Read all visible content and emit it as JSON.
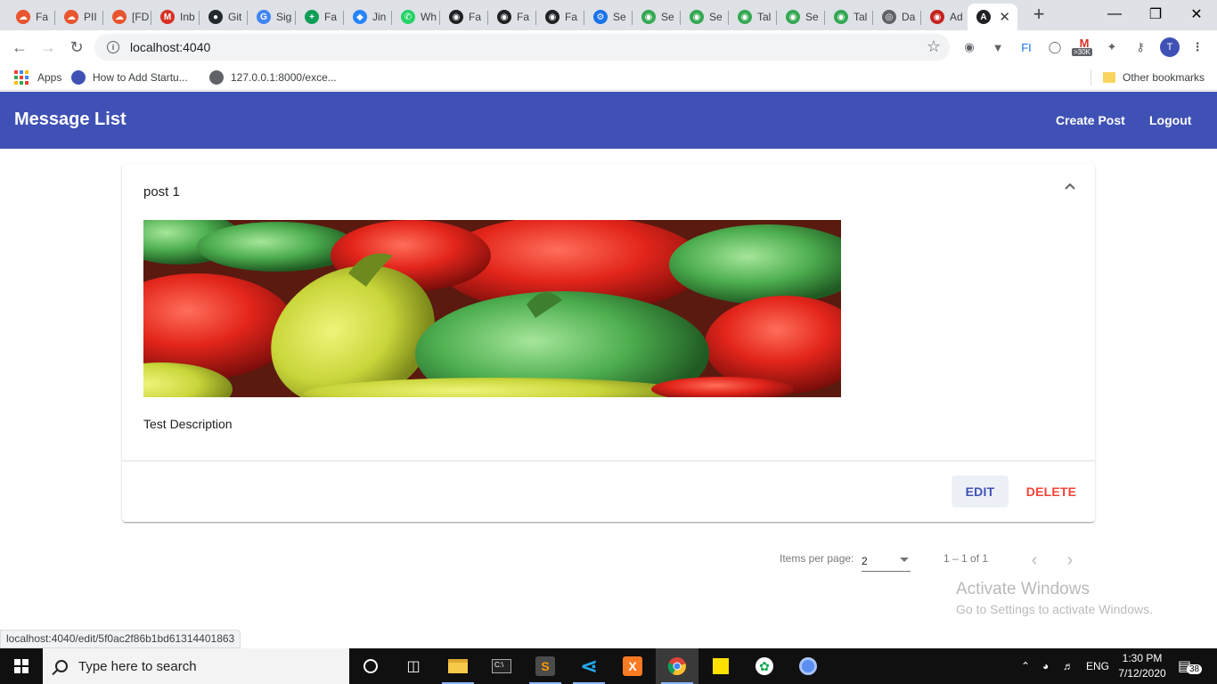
{
  "browser": {
    "tabs": [
      {
        "label": "Fa",
        "icon": "cloud-icon",
        "color": "#e8552f"
      },
      {
        "label": "PII",
        "icon": "cloud-icon",
        "color": "#e8552f"
      },
      {
        "label": "[FD",
        "icon": "cloud-icon",
        "color": "#e8552f"
      },
      {
        "label": "Inb",
        "icon": "gmail-icon",
        "color": "#d93025"
      },
      {
        "label": "Git",
        "icon": "github-icon",
        "color": "#24292e"
      },
      {
        "label": "Sig",
        "icon": "google-icon",
        "color": "#4285f4"
      },
      {
        "label": "Fa",
        "icon": "sheets-icon",
        "color": "#0f9d58"
      },
      {
        "label": "Jin",
        "icon": "jira-icon",
        "color": "#2684ff"
      },
      {
        "label": "Wh",
        "icon": "whatsapp-icon",
        "color": "#25d366"
      },
      {
        "label": "Fa",
        "icon": "site-icon",
        "color": "#202124"
      },
      {
        "label": "Fa",
        "icon": "site-icon",
        "color": "#202124"
      },
      {
        "label": "Fa",
        "icon": "site-icon",
        "color": "#202124"
      },
      {
        "label": "Se",
        "icon": "settings-icon",
        "color": "#1a73e8"
      },
      {
        "label": "Se",
        "icon": "site-icon",
        "color": "#34a853"
      },
      {
        "label": "Se",
        "icon": "site-icon",
        "color": "#34a853"
      },
      {
        "label": "Tal",
        "icon": "site-icon",
        "color": "#34a853"
      },
      {
        "label": "Se",
        "icon": "site-icon",
        "color": "#34a853"
      },
      {
        "label": "Tal",
        "icon": "site-icon",
        "color": "#34a853"
      },
      {
        "label": "Da",
        "icon": "globe-icon",
        "color": "#5f6368"
      },
      {
        "label": "Ad",
        "icon": "site-icon",
        "color": "#c5221f"
      }
    ],
    "active_tab": {
      "icon": "angular-icon",
      "color": "#202124"
    },
    "address": "localhost:4040",
    "bookmarks": {
      "apps_label": "Apps",
      "item1": "How to Add Startu...",
      "item2": "127.0.0.1:8000/exce...",
      "other": "Other bookmarks"
    },
    "ext_badge": ">30K",
    "profile_initial": "T"
  },
  "app": {
    "title": "Message List",
    "nav": {
      "create": "Create Post",
      "logout": "Logout"
    },
    "post": {
      "title": "post 1",
      "description": "Test Description",
      "edit_label": "EDIT",
      "delete_label": "DELETE"
    },
    "paginator": {
      "items_per_page_label": "Items per page:",
      "page_size": "2",
      "range": "1 – 1 of 1"
    }
  },
  "status_url": "localhost:4040/edit/5f0ac2f86b1bd61314401863",
  "watermark": {
    "line1": "Activate Windows",
    "line2": "Go to Settings to activate Windows."
  },
  "taskbar": {
    "search_placeholder": "Type here to search",
    "lang": "ENG",
    "time": "1:30 PM",
    "date": "7/12/2020",
    "notifications": "38"
  },
  "colors": {
    "primary": "#3f51b5",
    "warn": "#f44336"
  }
}
